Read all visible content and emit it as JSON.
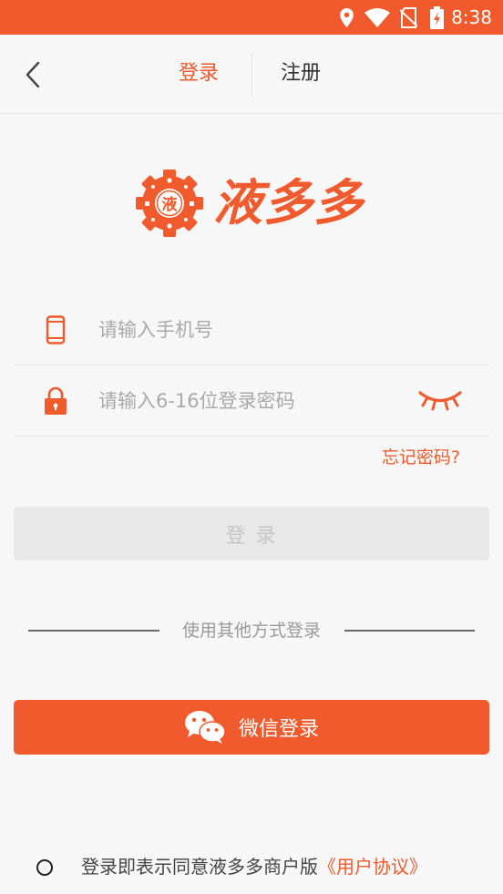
{
  "status_bar": {
    "time": "8:38",
    "icons": [
      "location-icon",
      "wifi-icon",
      "no-sim-icon",
      "battery-charging-icon"
    ]
  },
  "header": {
    "back_icon": "chevron-left-icon",
    "tabs": [
      {
        "label": "登录",
        "active": true
      },
      {
        "label": "注册",
        "active": false
      }
    ]
  },
  "logo": {
    "badge_text": "液",
    "name": "液多多"
  },
  "form": {
    "phone_icon": "phone-icon",
    "phone_placeholder": "请输入手机号",
    "lock_icon": "lock-icon",
    "password_placeholder": "请输入6-16位登录密码",
    "visibility_icon": "eye-closed-icon",
    "forgot_label": "忘记密码?"
  },
  "login_button": {
    "label": "登 录",
    "enabled": false
  },
  "alt_login": {
    "divider_text": "使用其他方式登录",
    "wechat_icon": "wechat-icon",
    "wechat_label": "微信登录"
  },
  "agreement": {
    "checked": false,
    "text": "登录即表示同意液多多商户版",
    "link": "《用户协议》"
  },
  "colors": {
    "accent": "#f05a2c",
    "background": "#f7f7f7",
    "disabled_button": "#e8e8e8",
    "placeholder": "#a9a9a9"
  }
}
